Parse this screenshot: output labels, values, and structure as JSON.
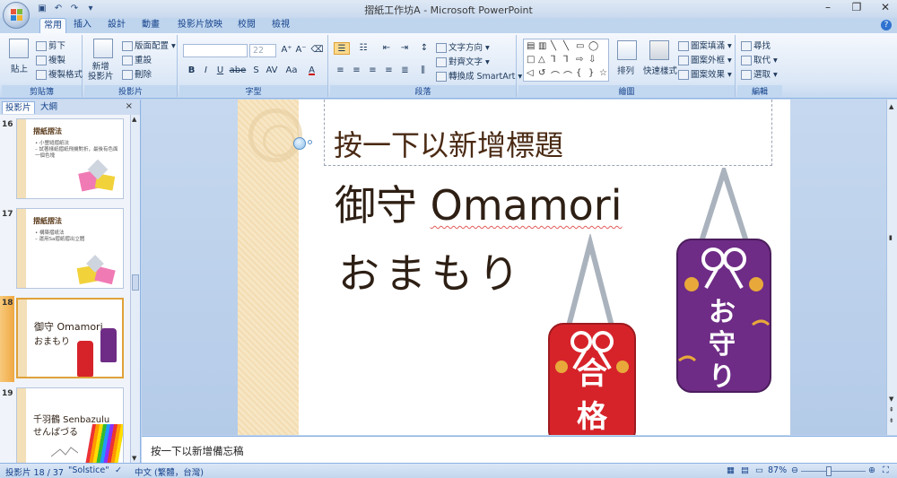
{
  "window": {
    "title": "摺紙工作坊A - Microsoft PowerPoint"
  },
  "quick_access": [
    "save-icon",
    "undo-icon",
    "redo-icon",
    "customize-icon"
  ],
  "tabs": [
    {
      "label": "常用",
      "active": true
    },
    {
      "label": "插入"
    },
    {
      "label": "設計"
    },
    {
      "label": "動畫"
    },
    {
      "label": "投影片放映"
    },
    {
      "label": "校閱"
    },
    {
      "label": "檢視"
    }
  ],
  "ribbon": {
    "clipboard": {
      "paste": "貼上",
      "cut": "剪下",
      "copy": "複製",
      "format_painter": "複製格式",
      "label": "剪貼簿"
    },
    "slides": {
      "new_slide": "新增\n投影片",
      "layout": "版面配置",
      "reset": "重設",
      "delete": "刪除",
      "label": "投影片"
    },
    "font": {
      "font_name": "",
      "font_size": "22",
      "label": "字型",
      "bold": "B",
      "italic": "I",
      "underline": "U",
      "strike": "abe",
      "shadow": "S",
      "spacing": "AV",
      "case": "Aa",
      "color": "A"
    },
    "paragraph": {
      "text_direction": "文字方向",
      "align_text": "對齊文字",
      "smartart": "轉換成 SmartArt",
      "label": "段落"
    },
    "drawing": {
      "arrange": "排列",
      "quick_styles": "快速樣式",
      "shape_fill": "圖案填滿",
      "shape_outline": "圖案外框",
      "shape_effects": "圖案效果",
      "label": "繪圖"
    },
    "editing": {
      "find": "尋找",
      "replace": "取代",
      "select": "選取",
      "label": "編輯"
    }
  },
  "panel": {
    "tabs": [
      "投影片",
      "大綱"
    ],
    "thumbnails": [
      {
        "number": "16",
        "title": "摺紙摺法",
        "lines": [
          "• 小豐縫摺紙法",
          "  – 試著樣紙摺紙飛機對折，最後有色面",
          "    一個色塊"
        ]
      },
      {
        "number": "17",
        "title": "摺紙摺法",
        "lines": [
          "• 構築摺紙法",
          "  – 運用Sa摺紙摺出立體"
        ]
      },
      {
        "number": "18",
        "title": "御守 Omamori",
        "subtitle": "おまもり",
        "selected": true
      },
      {
        "number": "19",
        "title": "千羽鶴 Senbazulu",
        "subtitle": "せんばづる"
      }
    ]
  },
  "slide": {
    "title_placeholder": "按一下以新增標題",
    "heading_kanji": "御守",
    "heading_latin": "Omamori",
    "heading_kana": "おまもり",
    "charm_red_text": [
      "合",
      "格"
    ],
    "charm_purple_text": [
      "お",
      "守",
      "り"
    ]
  },
  "notes_placeholder": "按一下以新增備忘稿",
  "status": {
    "slide_counter": "投影片 18 / 37",
    "theme": "\"Solstice\"",
    "language": "中文 (繁體，台灣)",
    "zoom": "87%"
  },
  "colors": {
    "accent": "#e0a13a",
    "red_charm": "#d6232a",
    "purple_charm": "#6e2c86",
    "gold": "#e8a93a"
  }
}
